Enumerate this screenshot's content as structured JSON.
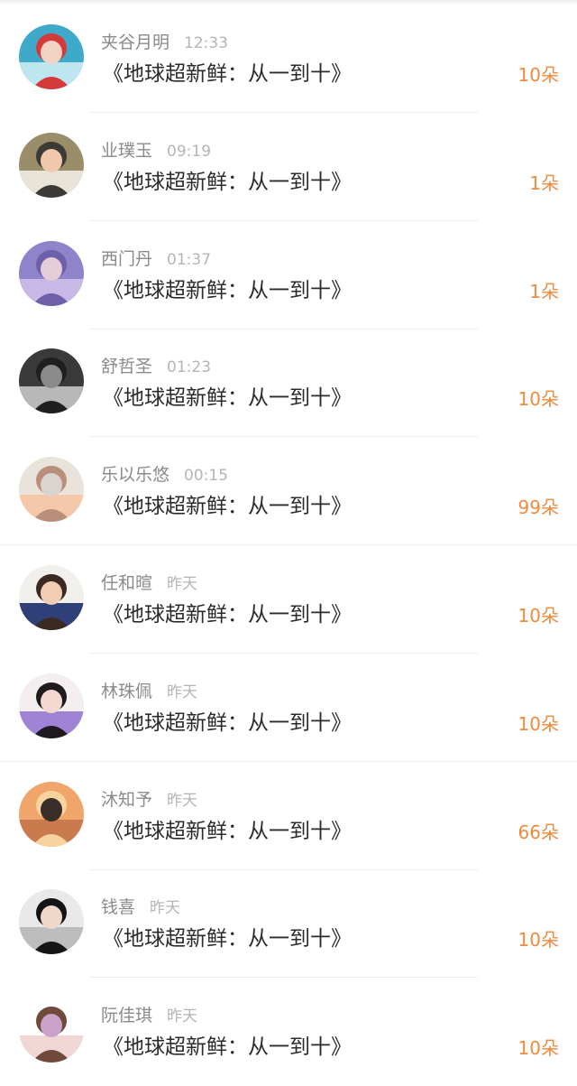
{
  "gift_list": [
    {
      "name": "夹谷月明",
      "time": "12:33",
      "title": "《地球超新鲜：从一到十》",
      "amount": "10朵",
      "avatar_colors": [
        "#3fa9c9",
        "#bfe6f0",
        "#f2d2c2",
        "#d43a3a"
      ],
      "avatar_icon": "user-photo-icon"
    },
    {
      "name": "业璞玉",
      "time": "09:19",
      "title": "《地球超新鲜：从一到十》",
      "amount": "1朵",
      "avatar_colors": [
        "#9a8d6a",
        "#e9e4d8",
        "#f0c9ac",
        "#3c3a36"
      ],
      "avatar_icon": "user-photo-icon"
    },
    {
      "name": "西门丹",
      "time": "01:37",
      "title": "《地球超新鲜：从一到十》",
      "amount": "1朵",
      "avatar_colors": [
        "#8f83c9",
        "#c8b8e6",
        "#e6ccd6",
        "#6d5fa8"
      ],
      "avatar_icon": "user-photo-icon"
    },
    {
      "name": "舒哲圣",
      "time": "01:23",
      "title": "《地球超新鲜：从一到十》",
      "amount": "10朵",
      "avatar_colors": [
        "#3a3a3a",
        "#b8b8b8",
        "#8a8a8a",
        "#1f1f1f"
      ],
      "avatar_icon": "user-photo-icon"
    },
    {
      "name": "乐以乐悠",
      "time": "00:15",
      "title": "《地球超新鲜：从一到十》",
      "amount": "99朵",
      "avatar_colors": [
        "#e9e3dc",
        "#f4c8a9",
        "#d9d4cf",
        "#b88f7a"
      ],
      "avatar_icon": "user-photo-icon"
    },
    {
      "name": "任和暄",
      "time": "昨天",
      "title": "《地球超新鲜：从一到十》",
      "amount": "10朵",
      "avatar_colors": [
        "#f2f0ec",
        "#2f3f78",
        "#f1cdb3",
        "#3a2a22"
      ],
      "avatar_icon": "user-photo-icon"
    },
    {
      "name": "林珠佩",
      "time": "昨天",
      "title": "《地球超新鲜：从一到十》",
      "amount": "10朵",
      "avatar_colors": [
        "#f4eeee",
        "#9f84d6",
        "#f5d8cf",
        "#1e1a1e"
      ],
      "avatar_icon": "user-photo-icon"
    },
    {
      "name": "沐知予",
      "time": "昨天",
      "title": "《地球超新鲜：从一到十》",
      "amount": "66朵",
      "avatar_colors": [
        "#f0a66a",
        "#c97a4e",
        "#3a2e2a",
        "#f7d3a0"
      ],
      "avatar_icon": "user-photo-icon"
    },
    {
      "name": "钱喜",
      "time": "昨天",
      "title": "《地球超新鲜：从一到十》",
      "amount": "10朵",
      "avatar_colors": [
        "#e9e9e9",
        "#bdbdbd",
        "#f0d8c8",
        "#141414"
      ],
      "avatar_icon": "user-photo-icon"
    },
    {
      "name": "阮佳琪",
      "time": "昨天",
      "title": "《地球超新鲜：从一到十》",
      "amount": "10朵",
      "avatar_colors": [
        "#ffffff",
        "#f1d6d6",
        "#c9a2c9",
        "#6f4a3a"
      ],
      "avatar_icon": "user-photo-icon"
    }
  ],
  "accent_color": "#f08a3c"
}
